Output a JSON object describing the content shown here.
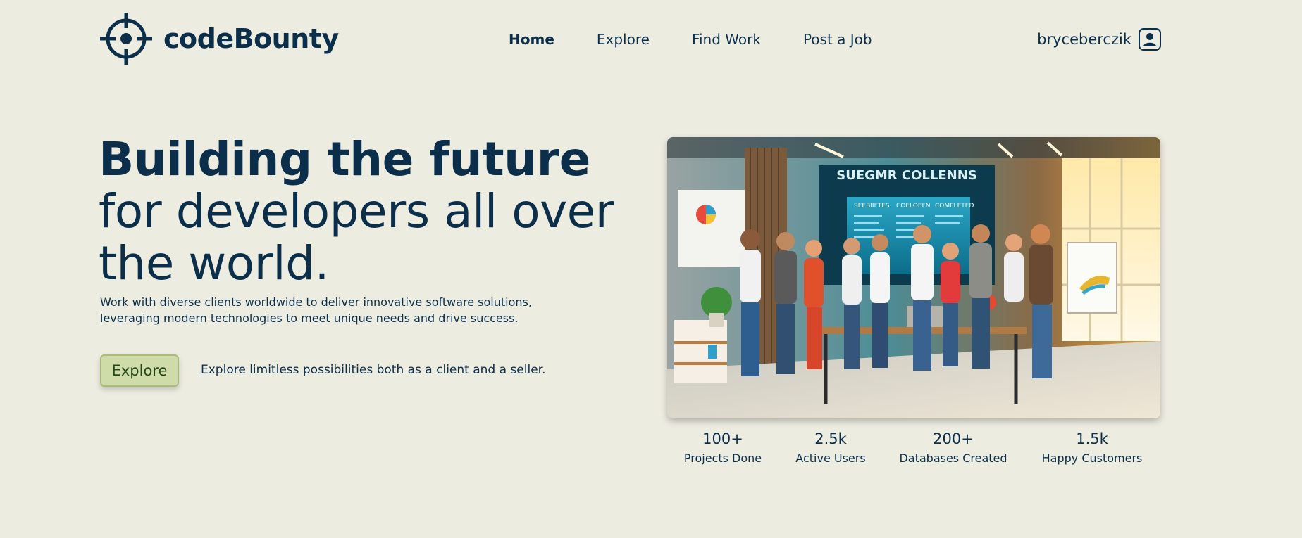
{
  "brand": {
    "name": "codeBounty",
    "icon": "crosshair-icon"
  },
  "nav": {
    "items": [
      {
        "label": "Home",
        "active": true
      },
      {
        "label": "Explore",
        "active": false
      },
      {
        "label": "Find Work",
        "active": false
      },
      {
        "label": "Post a Job",
        "active": false
      }
    ]
  },
  "user": {
    "name": "bryceberczik",
    "icon": "user-avatar-icon"
  },
  "hero": {
    "title_bold": "Building the future",
    "title_rest": " for developers all over the world.",
    "description": "Work with diverse clients worldwide to deliver innovative software solutions, leveraging modern technologies to meet unique needs and drive success.",
    "button_label": "Explore",
    "cta_text": "Explore limitless possibilities both as a client and a seller."
  },
  "image": {
    "board_title": "SUEGMR COLLENNS",
    "col1": "SEEBIIFTES",
    "col2": "COELOEFN",
    "col3": "COMPLETED"
  },
  "stats": [
    {
      "value": "100+",
      "label": "Projects Done"
    },
    {
      "value": "2.5k",
      "label": "Active Users"
    },
    {
      "value": "200+",
      "label": "Databases Created"
    },
    {
      "value": "1.5k",
      "label": "Happy Customers"
    }
  ],
  "colors": {
    "primary": "#0b2f4a",
    "background": "#edece1",
    "button": "#cfdcaa"
  }
}
